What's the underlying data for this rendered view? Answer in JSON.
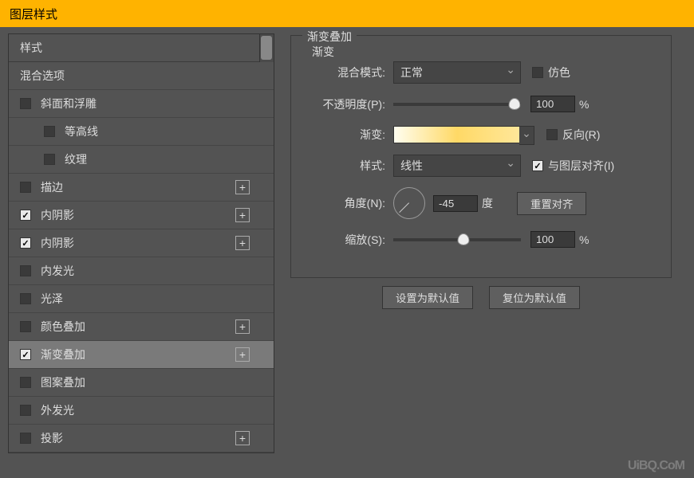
{
  "dialog_title": "图层样式",
  "sidebar": {
    "header": "样式",
    "blending_options": "混合选项",
    "items": [
      {
        "label": "斜面和浮雕",
        "checked": false,
        "hasPlus": false
      },
      {
        "label": "等高线",
        "checked": false,
        "hasPlus": false,
        "indent": true
      },
      {
        "label": "纹理",
        "checked": false,
        "hasPlus": false,
        "indent": true
      },
      {
        "label": "描边",
        "checked": false,
        "hasPlus": true
      },
      {
        "label": "内阴影",
        "checked": true,
        "hasPlus": true
      },
      {
        "label": "内阴影",
        "checked": true,
        "hasPlus": true
      },
      {
        "label": "内发光",
        "checked": false,
        "hasPlus": false
      },
      {
        "label": "光泽",
        "checked": false,
        "hasPlus": false
      },
      {
        "label": "颜色叠加",
        "checked": false,
        "hasPlus": true
      },
      {
        "label": "渐变叠加",
        "checked": true,
        "hasPlus": true,
        "selected": true
      },
      {
        "label": "图案叠加",
        "checked": false,
        "hasPlus": false
      },
      {
        "label": "外发光",
        "checked": false,
        "hasPlus": false
      },
      {
        "label": "投影",
        "checked": false,
        "hasPlus": true
      }
    ]
  },
  "main": {
    "section_title": "渐变叠加",
    "sub_title": "渐变",
    "blend_mode_label": "混合模式:",
    "blend_mode_value": "正常",
    "dither_label": "仿色",
    "dither_checked": false,
    "opacity_label": "不透明度(P):",
    "opacity_value": "100",
    "opacity_unit": "%",
    "opacity_thumb_pct": 95,
    "gradient_label": "渐变:",
    "reverse_label": "反向(R)",
    "reverse_checked": false,
    "style_label": "样式:",
    "style_value": "线性",
    "align_label": "与图层对齐(I)",
    "align_checked": true,
    "angle_label": "角度(N):",
    "angle_value": "-45",
    "angle_unit": "度",
    "reset_align_btn": "重置对齐",
    "scale_label": "缩放(S):",
    "scale_value": "100",
    "scale_unit": "%",
    "scale_thumb_pct": 55,
    "set_default_btn": "设置为默认值",
    "reset_default_btn": "复位为默认值"
  },
  "watermark": "UiBQ.CoM"
}
